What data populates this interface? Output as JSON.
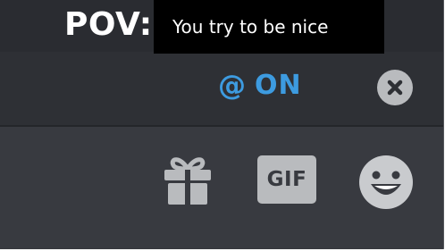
{
  "meme": {
    "pov": "POV:",
    "caption": "You try to be nice"
  },
  "reply_bar": {
    "mention_symbol": "@",
    "mention_state": "ON",
    "mention_color": "#3d9be0",
    "close_icon": "close-icon"
  },
  "input_toolbar": {
    "gift_icon": "gift-icon",
    "gif_label": "GIF",
    "emoji_icon": "smiley-emoji-icon"
  },
  "colors": {
    "panel_bg": "#2c2e33",
    "icon_gray": "#b9bbbe",
    "accent_blue": "#3d9be0"
  }
}
